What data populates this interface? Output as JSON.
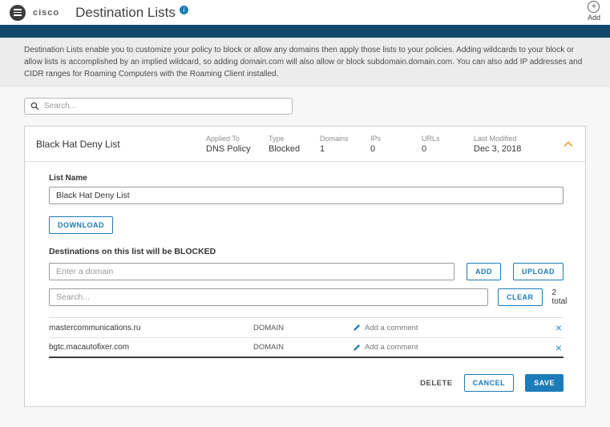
{
  "header": {
    "brand": "cisco",
    "title": "Destination Lists",
    "add_label": "Add"
  },
  "info_banner": {
    "text": "Destination Lists enable you to customize your policy to block or allow any domains then apply those lists to your policies. Adding wildcards to your block or allow lists is accomplished by an implied wildcard, so adding domain.com will also allow or block subdomain.domain.com. You can also add IP addresses and CIDR ranges for Roaming Computers with the Roaming Client installed."
  },
  "search": {
    "placeholder": "Search..."
  },
  "list_card": {
    "name": "Black Hat Deny List",
    "columns": [
      {
        "label": "Applied To",
        "value": "DNS Policy"
      },
      {
        "label": "Type",
        "value": "Blocked"
      },
      {
        "label": "Domains",
        "value": "1"
      },
      {
        "label": "IPs",
        "value": "0"
      },
      {
        "label": "URLs",
        "value": "0"
      },
      {
        "label": "Last Modified",
        "value": "Dec 3, 2018"
      }
    ],
    "detail": {
      "list_name_label": "List Name",
      "list_name_value": "Black Hat Deny List",
      "download_label": "DOWNLOAD",
      "destinations_label": "Destinations on this list will be BLOCKED",
      "domain_placeholder": "Enter a domain",
      "add_label": "ADD",
      "upload_label": "UPLOAD",
      "filter_placeholder": "Search...",
      "clear_label": "CLEAR",
      "total_label": "2 total",
      "rows": [
        {
          "destination": "mastercommunications.ru",
          "type": "DOMAIN",
          "comment": "Add a comment"
        },
        {
          "destination": "bgtc.macautofixer.com",
          "type": "DOMAIN",
          "comment": "Add a comment"
        }
      ],
      "delete_label": "DELETE",
      "cancel_label": "CANCEL",
      "save_label": "SAVE"
    }
  },
  "colors": {
    "accent_blue": "#1c7bb8",
    "navy_bar": "#11486b",
    "banner_bg": "#ececec",
    "page_bg": "#f7f7f7",
    "chevron_orange": "#e8a33d"
  }
}
